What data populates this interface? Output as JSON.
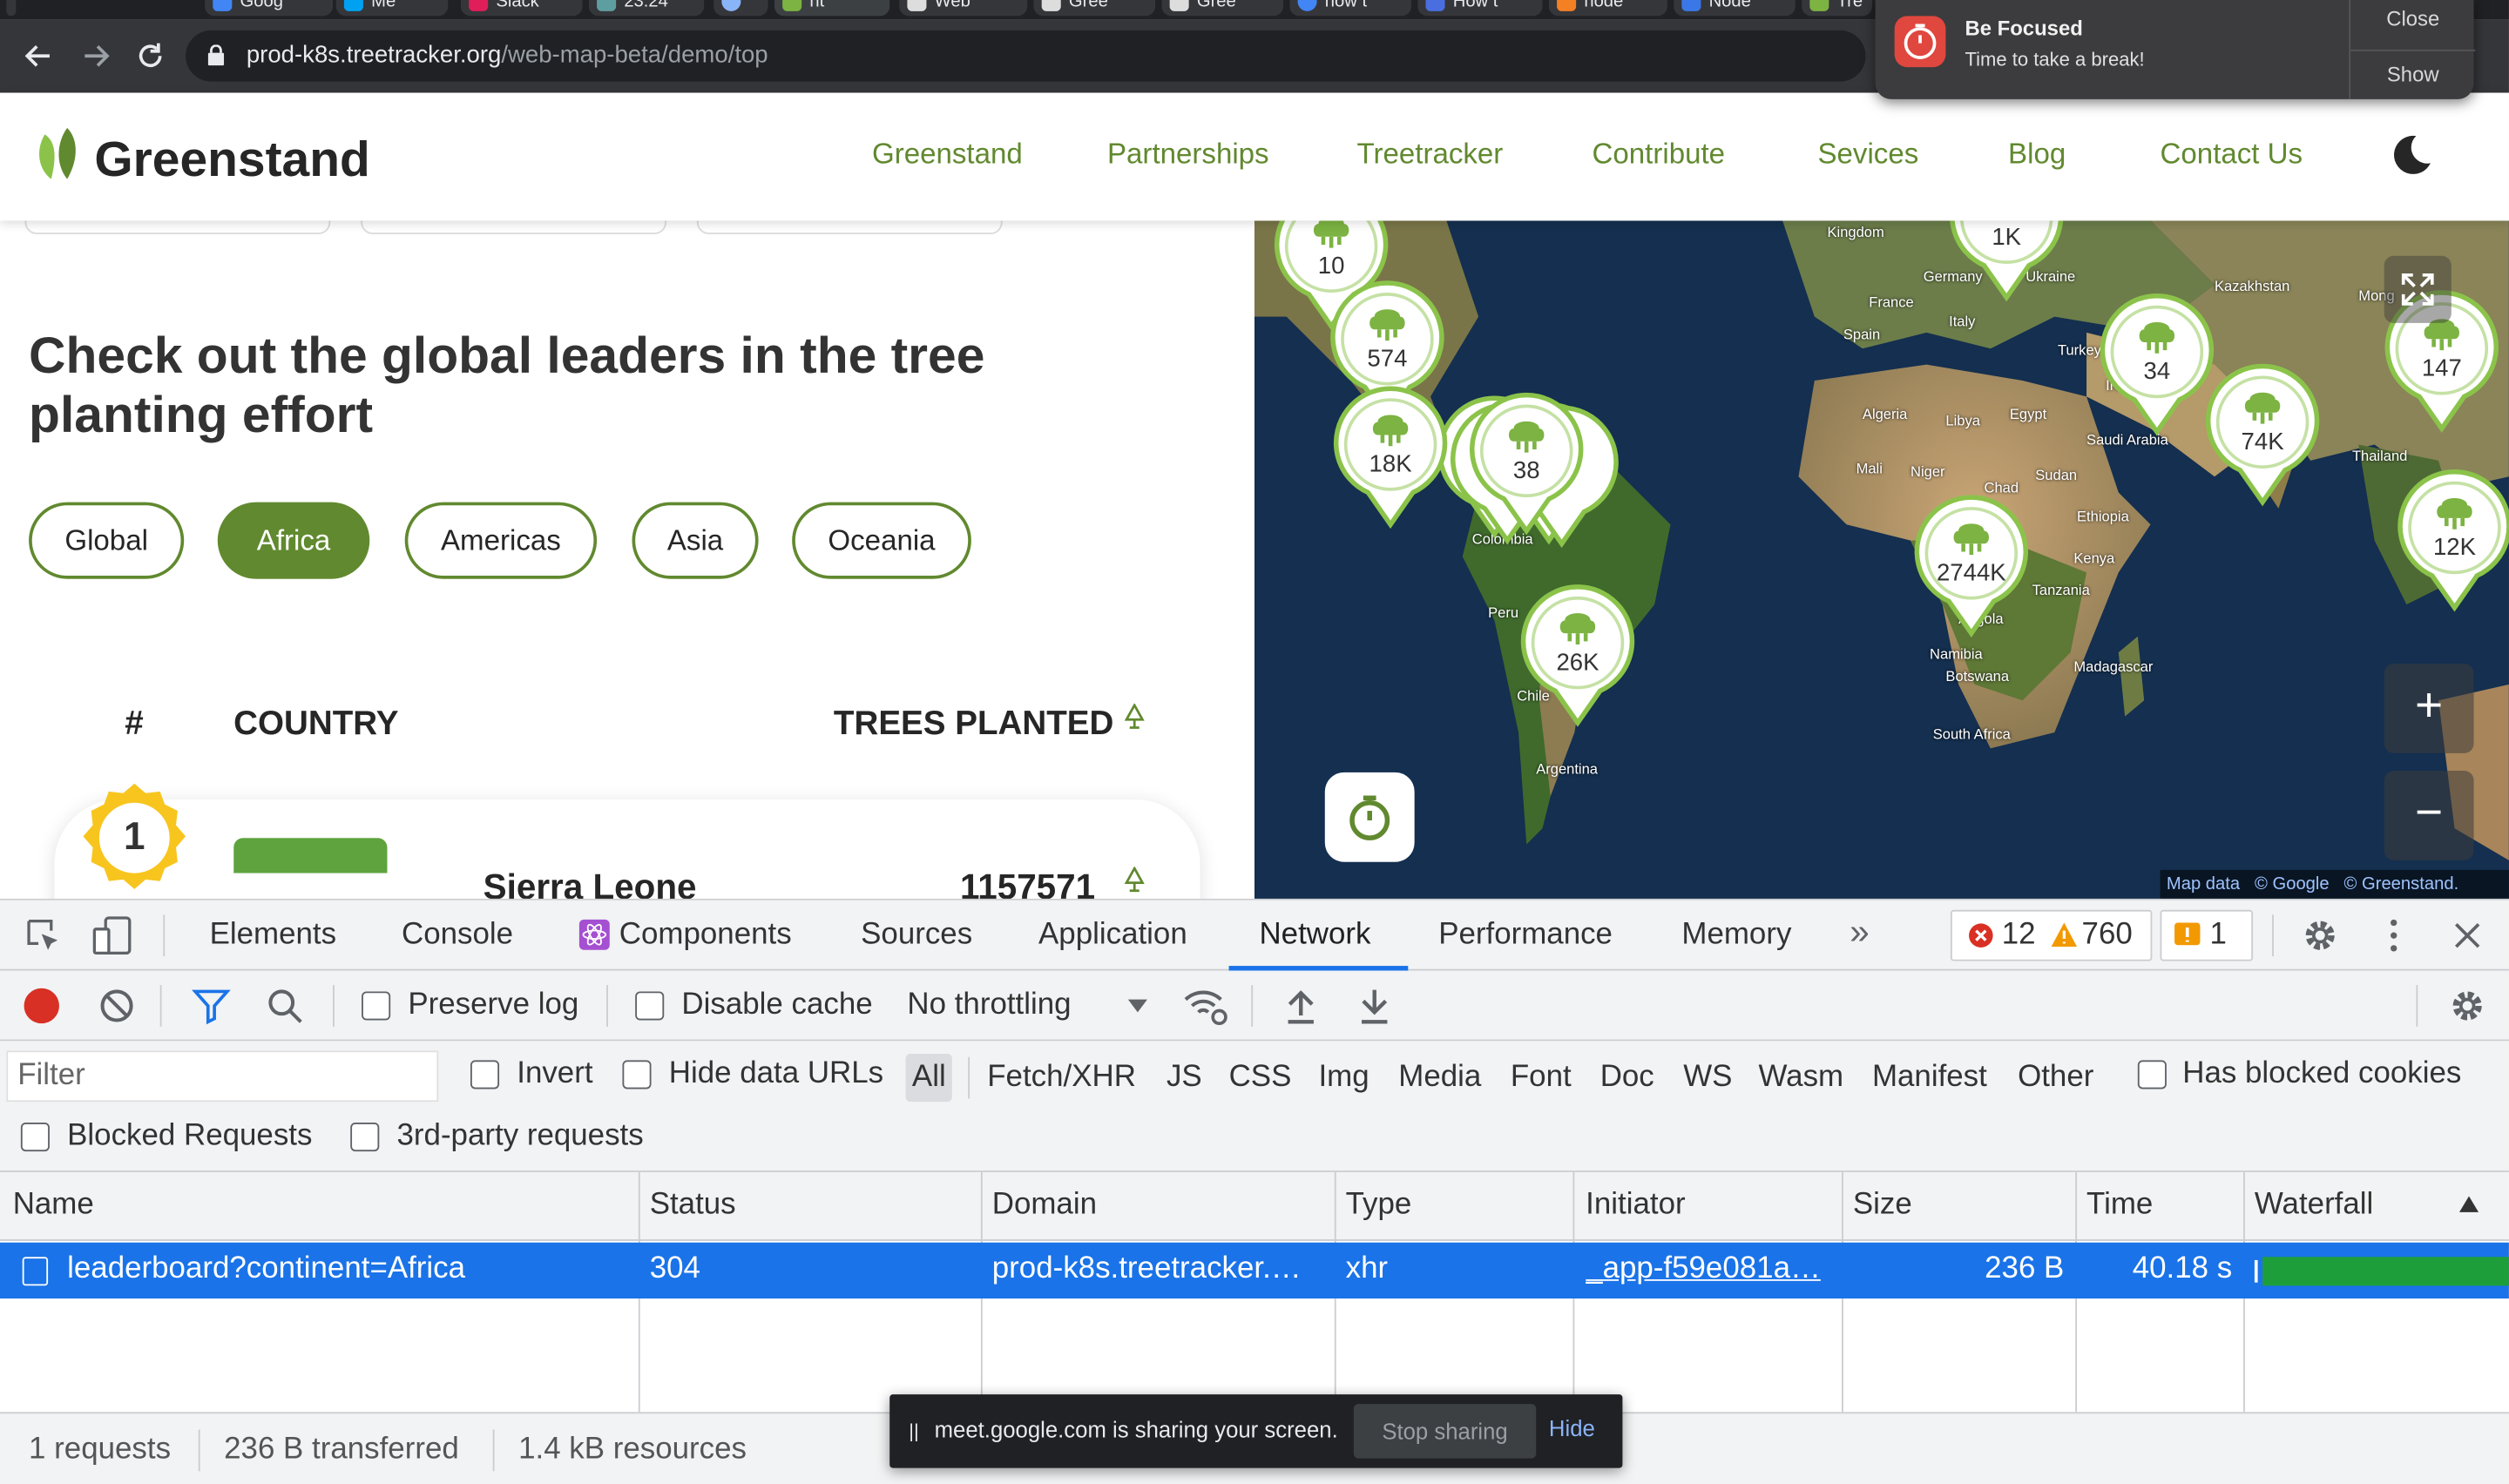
{
  "browser": {
    "tabs": [
      "Goog",
      "Me",
      "Slack",
      "23:24",
      "",
      "nt",
      "Web",
      "Gree",
      "Gree",
      "how t",
      "How t",
      "node",
      "Node",
      "Tre"
    ],
    "url_host": "prod-k8s.treetracker.org",
    "url_path": "/web-map-beta/demo/top",
    "back_icon": "arrow-left-icon",
    "forward_icon": "arrow-right-icon",
    "reload_icon": "reload-icon"
  },
  "notification": {
    "title": "Be Focused",
    "message": "Time to take a break!",
    "close_label": "Close",
    "show_label": "Show",
    "app_color": "#e0473f"
  },
  "site": {
    "brand": "Greenstand",
    "accent": "#61892f",
    "nav": [
      "Greenstand",
      "Partnerships",
      "Treetracker",
      "Contribute",
      "Sevices",
      "Blog",
      "Contact Us"
    ],
    "headline": "Check out the global leaders in the tree planting effort",
    "continents": [
      "Global",
      "Africa",
      "Americas",
      "Asia",
      "Oceania"
    ],
    "active_continent": "Africa",
    "table": {
      "col_rank": "#",
      "col_country": "COUNTRY",
      "col_trees": "TREES PLANTED",
      "rows": [
        {
          "rank": "1",
          "country": "Sierra Leone",
          "trees": "1157571"
        }
      ]
    }
  },
  "map": {
    "labels": [
      "Kingdom",
      "Germany",
      "Ukraine",
      "France",
      "Italy",
      "Kazakhstan",
      "Spain",
      "Turkey",
      "Mong",
      "Iraq",
      "Algeria",
      "Libya",
      "Egypt",
      "Saudi Arabia",
      "Mali",
      "Niger",
      "Chad",
      "Sudan",
      "Thailand",
      "Ethiopia",
      "Colombia",
      "Kenya",
      "Tanzania",
      "Peru",
      "Angola",
      "Namibia",
      "Madagascar",
      "Botswana",
      "Chile",
      "South Africa",
      "Argentina"
    ],
    "clusters": [
      "10",
      "574",
      "18K",
      "38",
      "1K",
      "34",
      "74K",
      "147",
      "2744K",
      "12K",
      "26K"
    ],
    "zoom_in": "+",
    "zoom_out": "−",
    "credits": [
      "Map data",
      "© Google",
      "© Greenstand."
    ]
  },
  "devtools": {
    "tabs": [
      "Elements",
      "Console",
      "Components",
      "Sources",
      "Application",
      "Network",
      "Performance",
      "Memory"
    ],
    "active_tab": "Network",
    "error_count": "12",
    "warning_count": "760",
    "issue_count": "1",
    "toolbar": {
      "preserve_log": "Preserve log",
      "disable_cache": "Disable cache",
      "throttling": "No throttling"
    },
    "filter": {
      "placeholder": "Filter",
      "invert": "Invert",
      "hide_data_urls": "Hide data URLs",
      "types": [
        "All",
        "Fetch/XHR",
        "JS",
        "CSS",
        "Img",
        "Media",
        "Font",
        "Doc",
        "WS",
        "Wasm",
        "Manifest",
        "Other"
      ],
      "has_blocked_cookies": "Has blocked cookies",
      "blocked_requests": "Blocked Requests",
      "third_party": "3rd-party requests"
    },
    "columns": [
      "Name",
      "Status",
      "Domain",
      "Type",
      "Initiator",
      "Size",
      "Time",
      "Waterfall"
    ],
    "requests": [
      {
        "name": "leaderboard?continent=Africa",
        "status": "304",
        "domain": "prod-k8s.treetracker.…",
        "type": "xhr",
        "initiator": "_app-f59e081a…",
        "size": "236 B",
        "time": "40.18 s"
      }
    ],
    "status": {
      "requests": "1 requests",
      "transferred": "236 B transferred",
      "resources": "1.4 kB resources"
    }
  },
  "sharebar": {
    "message": "meet.google.com is sharing your screen.",
    "stop": "Stop sharing",
    "hide": "Hide"
  }
}
